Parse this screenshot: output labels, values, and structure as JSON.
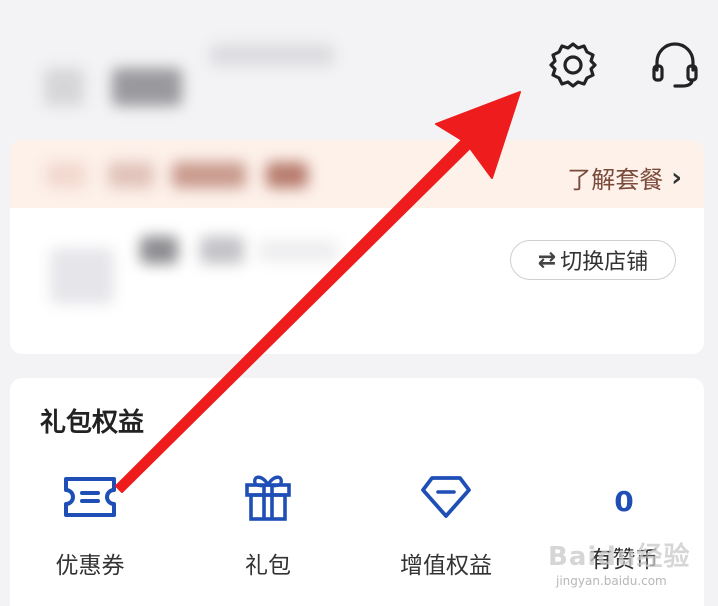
{
  "header": {
    "settings_icon": "gear-icon",
    "support_icon": "headset-icon"
  },
  "package": {
    "learn_label": "了解套餐",
    "chevron": "›",
    "bar_color": "#fdf1ea"
  },
  "store": {
    "switch_glyph": "⇄",
    "switch_label": "切换店铺"
  },
  "benefits": {
    "title": "礼包权益",
    "items": [
      {
        "label": "优惠券",
        "icon": "coupon-icon"
      },
      {
        "label": "礼包",
        "icon": "gift-icon"
      },
      {
        "label": "增值权益",
        "icon": "diamond-icon"
      },
      {
        "label": "有赞币",
        "value": "0"
      }
    ]
  },
  "annotation": {
    "arrow_color": "#ee1c1c"
  },
  "watermark": {
    "brand": "Baidu经验",
    "url": "jingyan.baidu.com"
  },
  "colors": {
    "accent_blue": "#1f4fb6",
    "link_brown": "#7a4a3a"
  }
}
